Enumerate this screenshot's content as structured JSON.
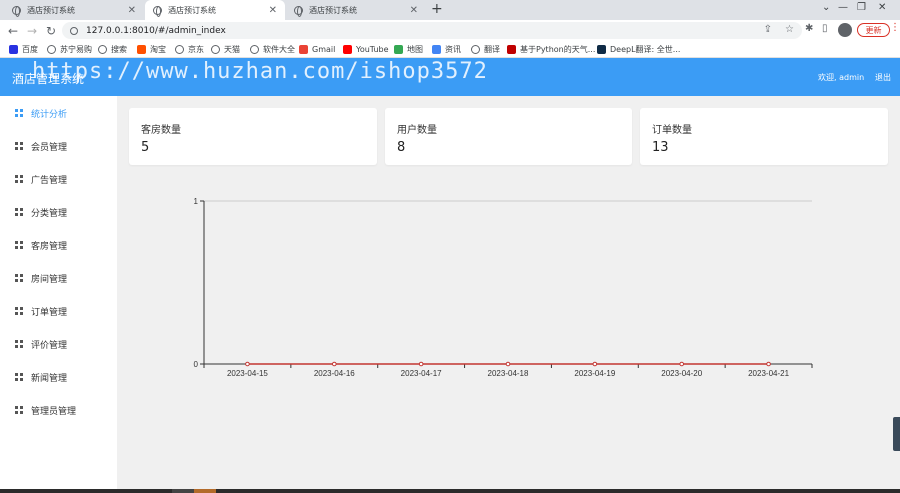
{
  "browser": {
    "tabs": [
      {
        "title": "酒店预订系统",
        "active": false
      },
      {
        "title": "酒店预订系统",
        "active": true
      },
      {
        "title": "酒店预订系统",
        "active": false
      }
    ],
    "url": "127.0.0.1:8010/#/admin_index",
    "update_label": "更新",
    "bookmarks": [
      {
        "label": "百度",
        "icon": "baidu-icon",
        "color": "#2932e1"
      },
      {
        "label": "苏宁易购",
        "icon": "globe-icon",
        "color": "#5f6368"
      },
      {
        "label": "搜索",
        "icon": "globe-icon",
        "color": "#5f6368"
      },
      {
        "label": "淘宝",
        "icon": "taobao-icon",
        "color": "#ff5000"
      },
      {
        "label": "京东",
        "icon": "globe-icon",
        "color": "#5f6368"
      },
      {
        "label": "天猫",
        "icon": "globe-icon",
        "color": "#5f6368"
      },
      {
        "label": "软件大全",
        "icon": "globe-icon",
        "color": "#5f6368"
      },
      {
        "label": "Gmail",
        "icon": "gmail-icon",
        "color": "#ea4335"
      },
      {
        "label": "YouTube",
        "icon": "youtube-icon",
        "color": "#ff0000"
      },
      {
        "label": "地图",
        "icon": "maps-icon",
        "color": "#34a853"
      },
      {
        "label": "资讯",
        "icon": "news-icon",
        "color": "#4285f4"
      },
      {
        "label": "翻译",
        "icon": "globe-icon",
        "color": "#5f6368"
      },
      {
        "label": "基于Python的天气...",
        "icon": "h-icon",
        "color": "#c00000"
      },
      {
        "label": "DeepL翻译: 全世...",
        "icon": "deepl-icon",
        "color": "#0f2b46"
      }
    ]
  },
  "header": {
    "title": "酒店管理系统",
    "watermark": "https://www.huzhan.com/ishop3572",
    "welcome": "欢迎, admin",
    "logout": "退出"
  },
  "sidebar": {
    "items": [
      {
        "label": "统计分析",
        "active": true
      },
      {
        "label": "会员管理",
        "active": false
      },
      {
        "label": "广告管理",
        "active": false
      },
      {
        "label": "分类管理",
        "active": false
      },
      {
        "label": "客房管理",
        "active": false
      },
      {
        "label": "房间管理",
        "active": false
      },
      {
        "label": "订单管理",
        "active": false
      },
      {
        "label": "评价管理",
        "active": false
      },
      {
        "label": "新闻管理",
        "active": false
      },
      {
        "label": "管理员管理",
        "active": false
      }
    ]
  },
  "stats": [
    {
      "label": "客房数量",
      "value": "5"
    },
    {
      "label": "用户数量",
      "value": "8"
    },
    {
      "label": "订单数量",
      "value": "13"
    }
  ],
  "colors": {
    "accent": "#3b9cf5",
    "line": "#c23531"
  },
  "chart_data": {
    "type": "line",
    "title": "",
    "xlabel": "",
    "ylabel": "",
    "categories": [
      "2023-04-15",
      "2023-04-16",
      "2023-04-17",
      "2023-04-18",
      "2023-04-19",
      "2023-04-20",
      "2023-04-21"
    ],
    "series": [
      {
        "values": [
          0,
          0,
          0,
          0,
          0,
          0,
          0
        ]
      }
    ],
    "ylim": [
      0,
      1
    ],
    "yticks": [
      "0",
      "1"
    ],
    "grid": true
  }
}
